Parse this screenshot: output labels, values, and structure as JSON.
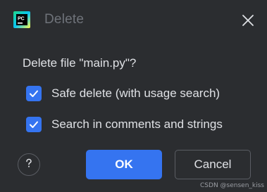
{
  "dialog": {
    "title": "Delete",
    "close_icon": "close-icon",
    "app_icon": "pycharm-logo-icon"
  },
  "content": {
    "question": "Delete file \"main.py\"?",
    "options": [
      {
        "label": "Safe delete (with usage search)",
        "checked": true
      },
      {
        "label": "Search in comments and strings",
        "checked": true
      }
    ]
  },
  "buttons": {
    "help_icon": "question-mark-icon",
    "ok_label": "OK",
    "cancel_label": "Cancel"
  },
  "watermark": "CSDN @sensen_kiss",
  "colors": {
    "background": "#2b2d30",
    "accent": "#3574f0",
    "text": "#dfe1e5",
    "muted_text": "#6f737a",
    "border": "#5a5d63"
  }
}
